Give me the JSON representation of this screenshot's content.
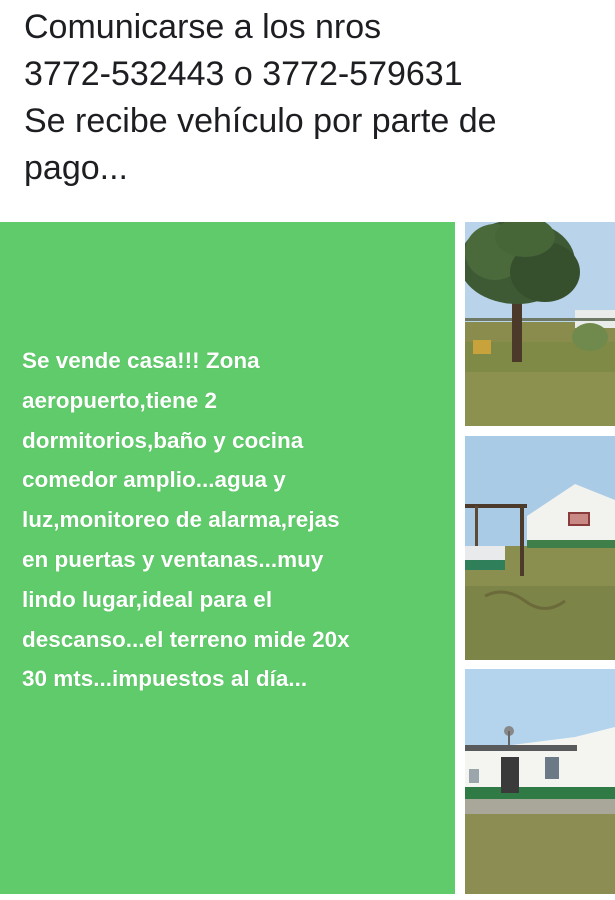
{
  "post": {
    "caption_lines": [
      "Comunicarse a los nros",
      "3772-532443 o 3772-579631",
      "Se recibe vehículo por parte de",
      "pago..."
    ]
  },
  "ad_card": {
    "background_color": "#5fcb6a",
    "text_lines": [
      "Se vende casa!!! Zona",
      "aeropuerto,tiene 2",
      "dormitorios,baño y cocina",
      "comedor amplio...agua y",
      "luz,monitoreo de alarma,rejas",
      "en puertas y ventanas...muy",
      "lindo lugar,ideal para el",
      "descanso...el terreno mide 20x",
      "30 mts...impuestos al día..."
    ]
  },
  "photos": [
    {
      "subject": "tree-and-yard"
    },
    {
      "subject": "white-house-side"
    },
    {
      "subject": "white-house-front"
    }
  ]
}
